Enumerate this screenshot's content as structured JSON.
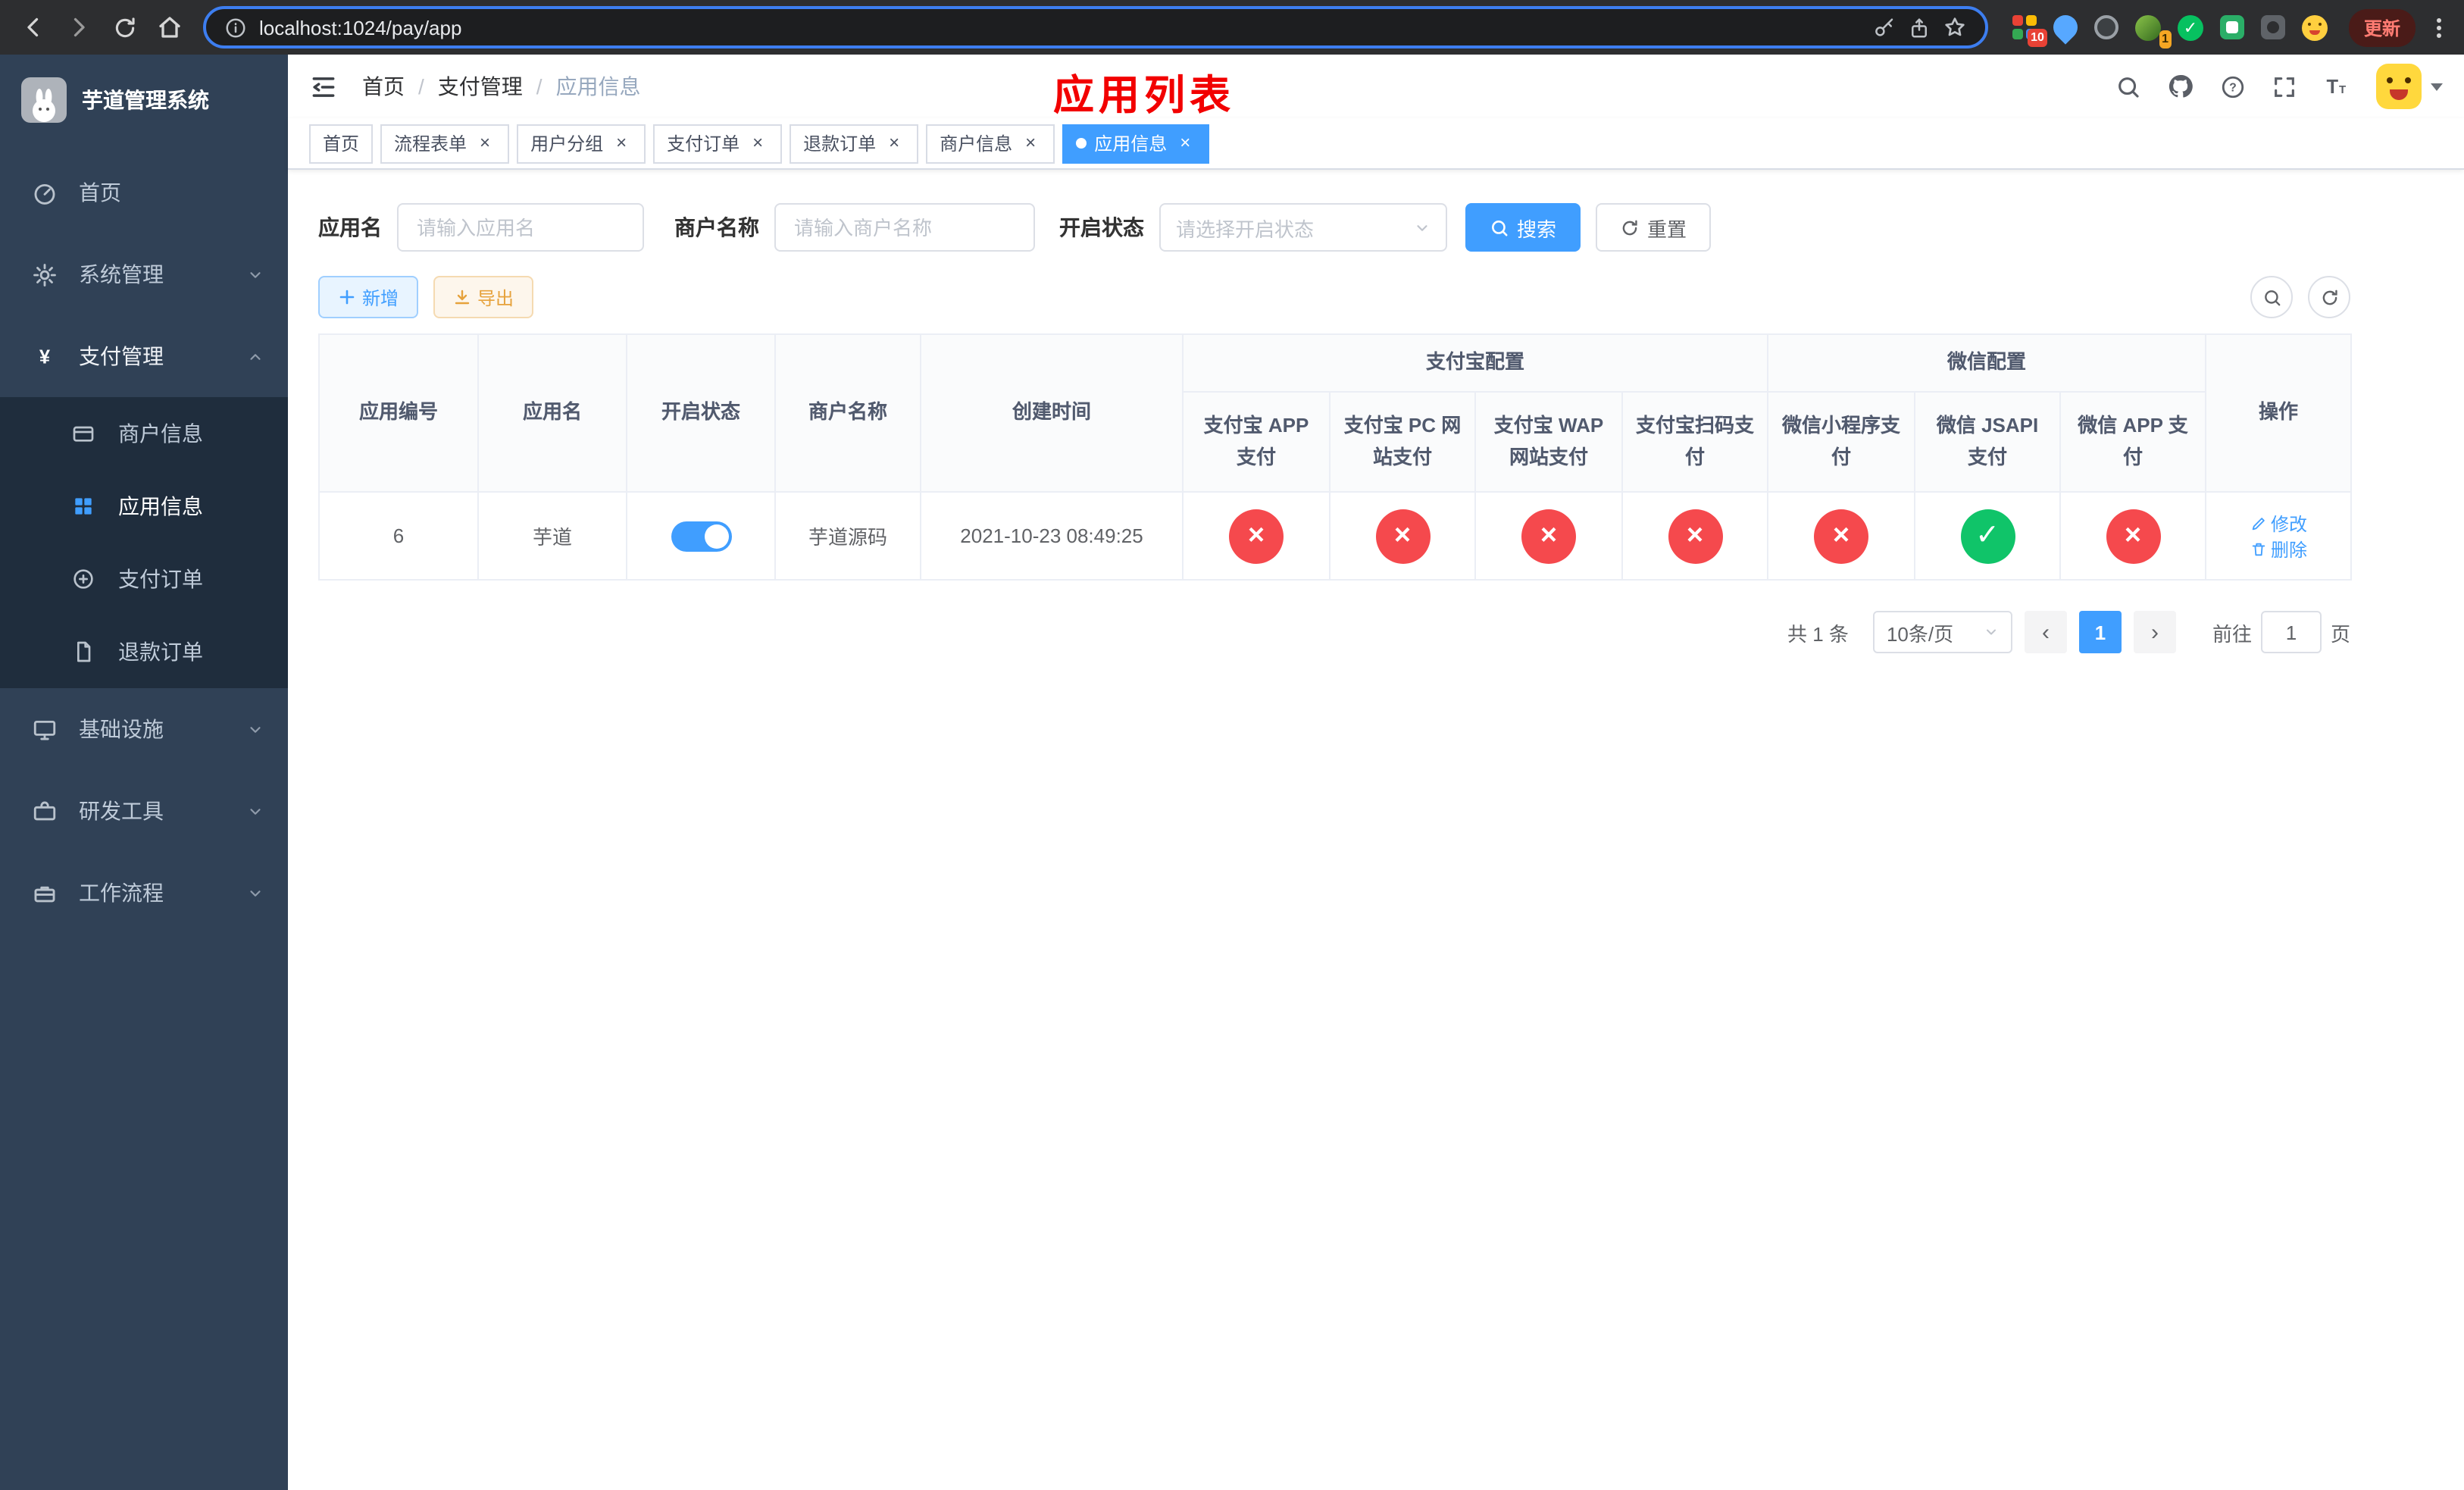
{
  "colors": {
    "accent": "#409eff",
    "danger": "#f5494d",
    "success": "#10c469",
    "warning": "#e6a23c",
    "sidebar_bg": "#304156",
    "submenu_bg": "#1f2d3d"
  },
  "browser": {
    "url": "localhost:1024/pay/app",
    "update_label": "更新",
    "ext_badge_1": "10",
    "ext_badge_2": "1"
  },
  "sidebar": {
    "title": "芋道管理系统",
    "items": [
      {
        "label": "首页"
      },
      {
        "label": "系统管理"
      },
      {
        "label": "支付管理"
      },
      {
        "label": "基础设施"
      },
      {
        "label": "研发工具"
      },
      {
        "label": "工作流程"
      }
    ],
    "submenu": [
      {
        "label": "商户信息"
      },
      {
        "label": "应用信息"
      },
      {
        "label": "支付订单"
      },
      {
        "label": "退款订单"
      }
    ]
  },
  "header": {
    "breadcrumb": [
      "首页",
      "支付管理",
      "应用信息"
    ],
    "overlay_title": "应用列表"
  },
  "tabs": [
    {
      "label": "首页",
      "closable": false
    },
    {
      "label": "流程表单",
      "closable": true
    },
    {
      "label": "用户分组",
      "closable": true
    },
    {
      "label": "支付订单",
      "closable": true
    },
    {
      "label": "退款订单",
      "closable": true
    },
    {
      "label": "商户信息",
      "closable": true
    },
    {
      "label": "应用信息",
      "closable": true,
      "active": true
    }
  ],
  "filters": {
    "app_name_label": "应用名",
    "app_name_placeholder": "请输入应用名",
    "merchant_label": "商户名称",
    "merchant_placeholder": "请输入商户名称",
    "status_label": "开启状态",
    "status_placeholder": "请选择开启状态",
    "search_label": "搜索",
    "reset_label": "重置"
  },
  "toolbar": {
    "add_label": "新增",
    "export_label": "导出"
  },
  "table": {
    "group_headers": {
      "alipay": "支付宝配置",
      "wechat": "微信配置"
    },
    "columns": [
      "应用编号",
      "应用名",
      "开启状态",
      "商户名称",
      "创建时间",
      "操作"
    ],
    "pay_columns": [
      "支付宝 APP 支付",
      "支付宝 PC 网站支付",
      "支付宝 WAP 网站支付",
      "支付宝扫码支付",
      "微信小程序支付",
      "微信 JSAPI 支付",
      "微信 APP 支付"
    ],
    "row": {
      "id": "6",
      "name": "芋道",
      "status_on": true,
      "merchant": "芋道源码",
      "created_at": "2021-10-23 08:49:25",
      "pay_flags": [
        false,
        false,
        false,
        false,
        false,
        true,
        false
      ],
      "edit_label": "修改",
      "delete_label": "删除"
    }
  },
  "pagination": {
    "total": "共 1 条",
    "page_size": "10条/页",
    "current_page": "1",
    "goto_prefix": "前往",
    "goto_value": "1",
    "goto_suffix": "页"
  }
}
